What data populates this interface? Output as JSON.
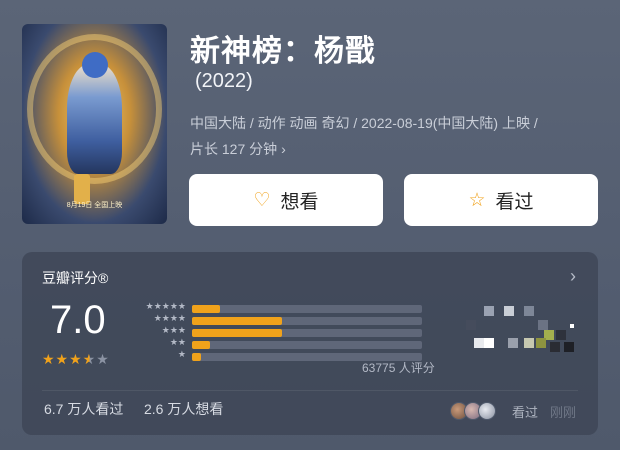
{
  "movie": {
    "title": "新神榜：杨戬",
    "year": "(2022)",
    "meta_line1": "中国大陆 / 动作 动画 奇幻 / 2022-08-19(中国大陆) 上映 /",
    "meta_line2": "片长 127 分钟",
    "meta_chevron": "›",
    "poster_date": "8月19日 全国上映"
  },
  "actions": {
    "want_icon": "heart-plus-icon",
    "want_glyph": "♡",
    "want_label": "想看",
    "seen_icon": "star-outline-icon",
    "seen_glyph": "☆",
    "seen_label": "看过"
  },
  "rating": {
    "header": "豆瓣评分®",
    "chevron": "›",
    "score": "7.0",
    "stars_value": 3.5,
    "stars_on": "★★★",
    "stars_half": "★",
    "stars_off": "★",
    "rows": [
      {
        "label": "★★★★★",
        "percent": 0.12
      },
      {
        "label": "★★★★",
        "percent": 0.39
      },
      {
        "label": "★★★",
        "percent": 0.39
      },
      {
        "label": "★★",
        "percent": 0.08
      },
      {
        "label": "★",
        "percent": 0.04
      }
    ],
    "count": "63775 人评分",
    "watched": "6.7 万人看过",
    "wishing": "2.6 万人想看",
    "recent_seen_label": "看过",
    "recent_time_label": "刚刚"
  },
  "colors": {
    "accent": "#f0a21b",
    "background": "#555f72",
    "card": "#3c4454"
  }
}
